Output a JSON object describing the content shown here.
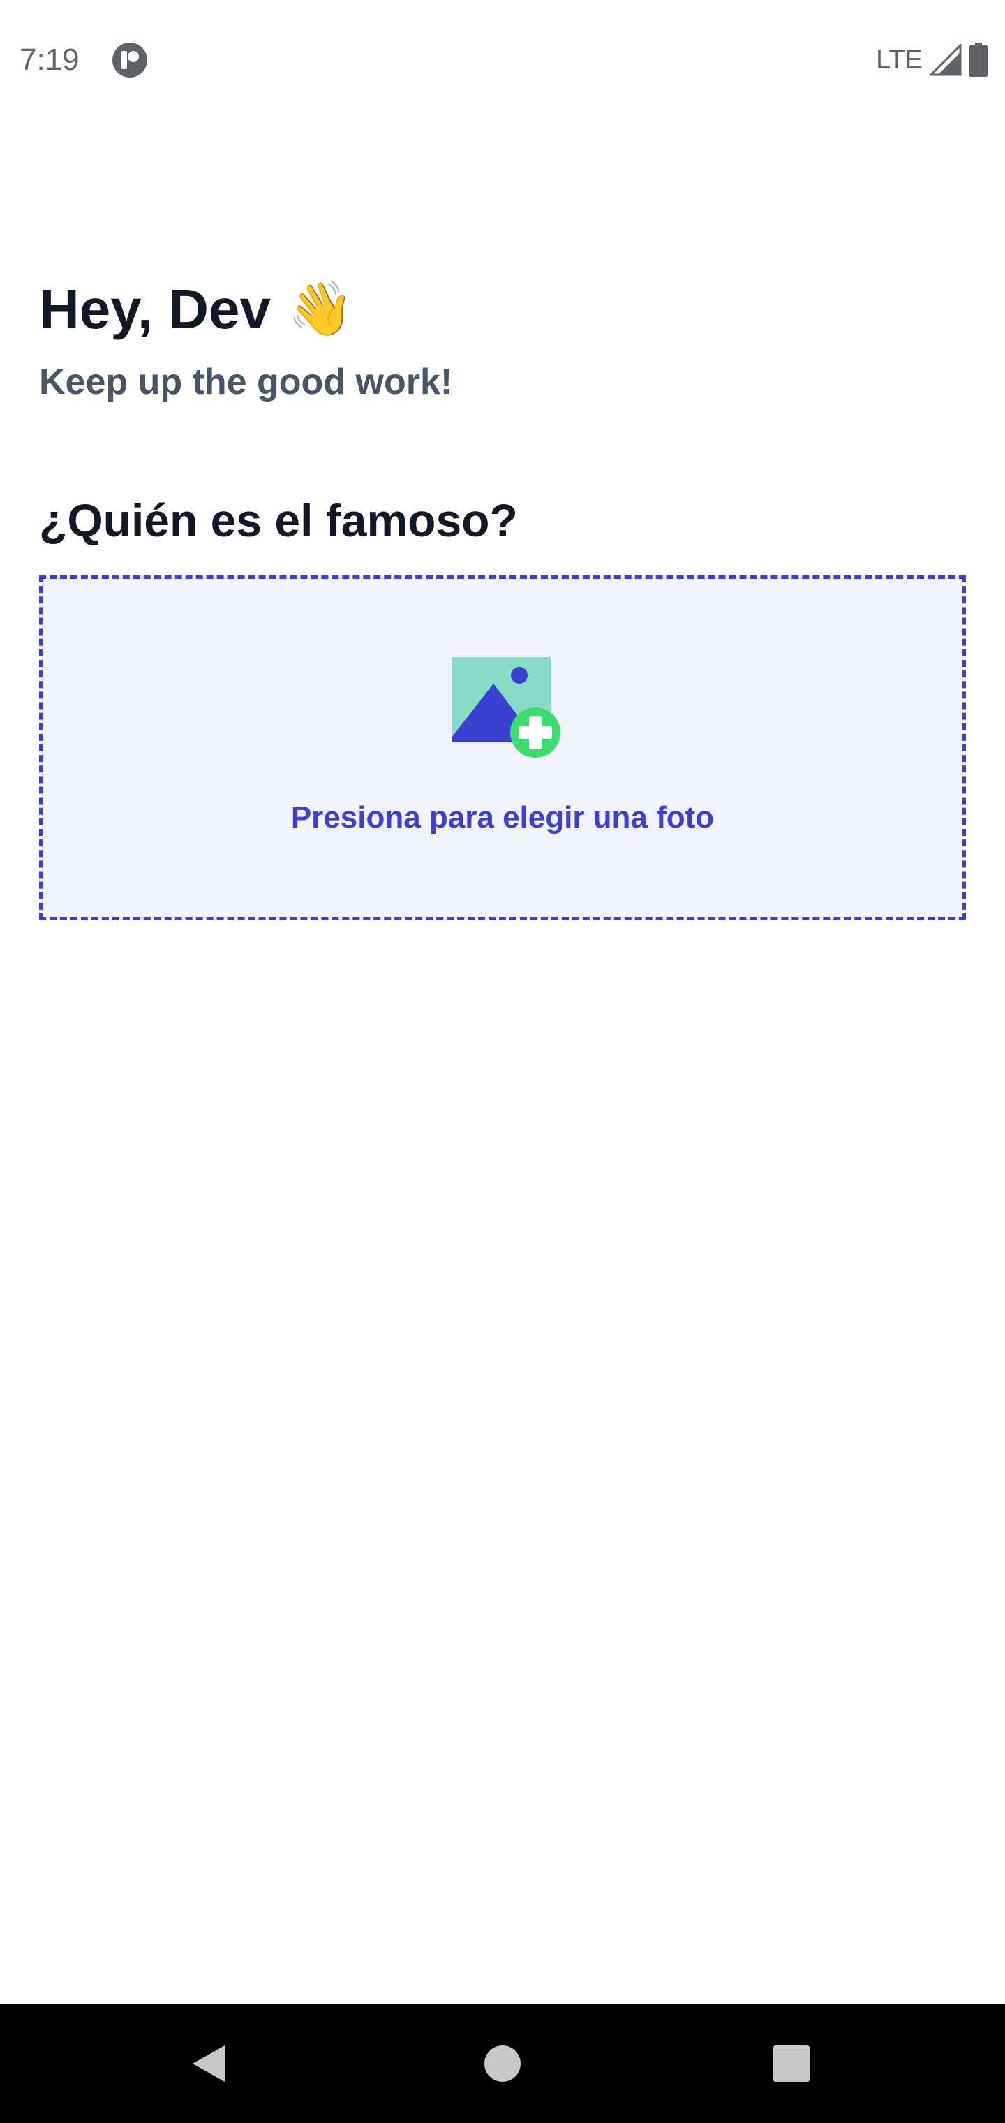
{
  "status_bar": {
    "time": "7:19",
    "network": "LTE",
    "icons": [
      "app-notification-icon",
      "signal-icon",
      "battery-icon"
    ]
  },
  "header": {
    "greeting": "Hey, Dev",
    "greeting_emoji": "👋",
    "subtitle": "Keep up the good work!"
  },
  "main": {
    "section_title": "¿Quién es el famoso?",
    "picker": {
      "label": "Presiona para elegir una foto",
      "icon": "add-image-icon"
    }
  },
  "nav_bar": {
    "buttons": [
      "back-icon",
      "home-icon",
      "recents-icon"
    ]
  },
  "colors": {
    "accent": "#3b40d0",
    "title": "#111827",
    "subtitle": "#475569",
    "picker_bg": "#f0f3f9",
    "image_icon_bg": "#86dcc6",
    "plus_badge": "#3ddc6e"
  }
}
